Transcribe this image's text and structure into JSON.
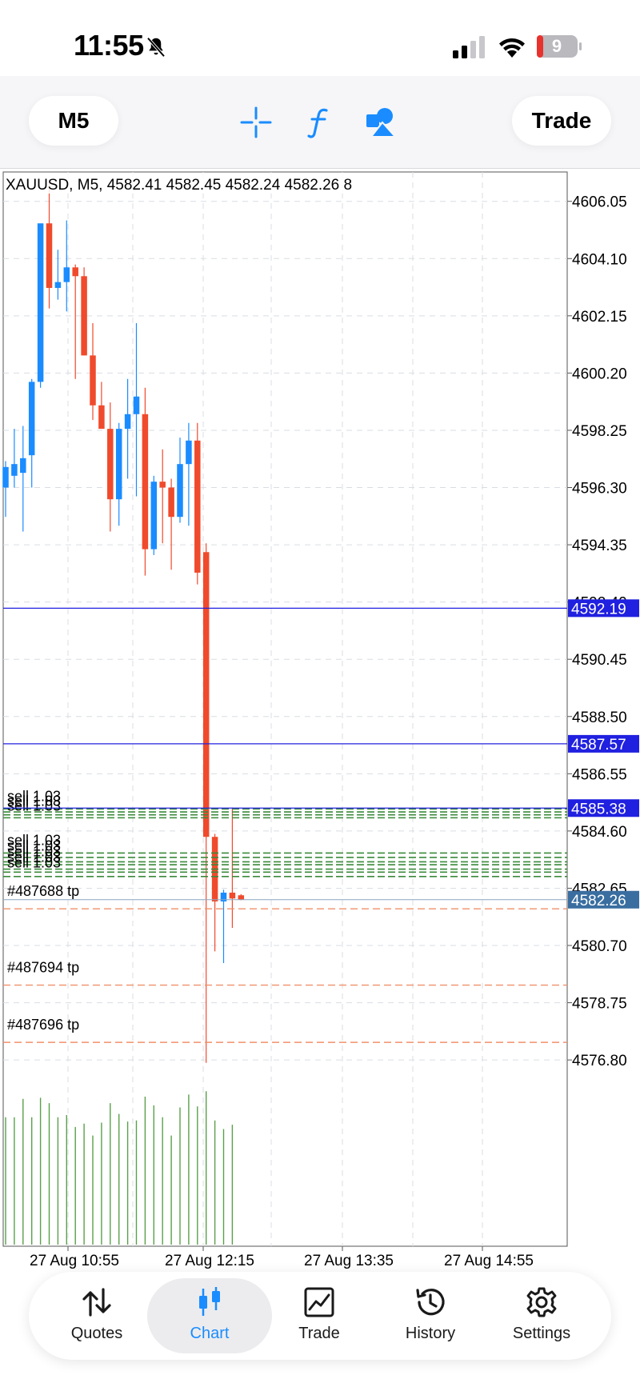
{
  "status_bar": {
    "time": "11:55",
    "battery": "9"
  },
  "toolbar": {
    "timeframe": "M5",
    "trade_label": "Trade"
  },
  "colors": {
    "bull": "#1a8cff",
    "bear": "#f04a2c",
    "hline": "#2020e0",
    "order": "#3a8a3a",
    "tp": "#f0906a",
    "last_price": "#3a6ea0",
    "grid": "#d9dde3",
    "volume": "#5aa04a"
  },
  "chart_data": {
    "type": "candlestick",
    "title": "XAUUSD, M5, 4582.41 4582.45 4582.24 4582.26 8",
    "ylim": [
      4575.85,
      4607.05
    ],
    "y_ticks": [
      "4606.05",
      "4604.10",
      "4602.15",
      "4600.20",
      "4598.25",
      "4596.30",
      "4594.35",
      "4592.40",
      "4590.45",
      "4588.50",
      "4586.55",
      "4584.60",
      "4582.65",
      "4580.70",
      "4578.75",
      "4576.80"
    ],
    "x_ticks": [
      "27 Aug 10:55",
      "27 Aug 12:15",
      "27 Aug 13:35",
      "27 Aug 14:55"
    ],
    "price_levels": [
      {
        "label": "4592.19",
        "value": 4592.19,
        "style": "blue"
      },
      {
        "label": "4587.57",
        "value": 4587.57,
        "style": "blue"
      },
      {
        "label": "4585.38",
        "value": 4585.38,
        "style": "blue"
      },
      {
        "label": "4582.26",
        "value": 4582.26,
        "style": "last"
      }
    ],
    "order_lines": {
      "upper_label": "sell 1.03",
      "upper_values": [
        4585.35,
        4585.25,
        4585.15,
        4585.05
      ],
      "lower_label": "sell 1.03",
      "lower_values": [
        4583.85,
        4583.7,
        4583.55,
        4583.45,
        4583.3,
        4583.2,
        4583.05
      ]
    },
    "tp_lines": [
      {
        "label": "#487688 tp",
        "value": 4581.95
      },
      {
        "label": "#487694 tp",
        "value": 4579.35
      },
      {
        "label": "#487696 tp",
        "value": 4577.4
      }
    ],
    "candles": [
      {
        "o": 4596.3,
        "h": 4597.2,
        "l": 4595.3,
        "c": 4597.0
      },
      {
        "o": 4596.7,
        "h": 4598.3,
        "l": 4596.3,
        "c": 4597.1
      },
      {
        "o": 4596.8,
        "h": 4598.4,
        "l": 4594.8,
        "c": 4597.3
      },
      {
        "o": 4597.4,
        "h": 4600.0,
        "l": 4596.3,
        "c": 4599.9
      },
      {
        "o": 4599.9,
        "h": 4605.0,
        "l": 4599.7,
        "c": 4605.3
      },
      {
        "o": 4605.3,
        "h": 4606.7,
        "l": 4602.4,
        "c": 4603.1
      },
      {
        "o": 4603.1,
        "h": 4604.4,
        "l": 4602.7,
        "c": 4603.3
      },
      {
        "o": 4603.3,
        "h": 4605.4,
        "l": 4602.3,
        "c": 4603.8
      },
      {
        "o": 4603.8,
        "h": 4603.9,
        "l": 4600.0,
        "c": 4603.5
      },
      {
        "o": 4603.5,
        "h": 4603.8,
        "l": 4600.8,
        "c": 4600.8
      },
      {
        "o": 4600.8,
        "h": 4601.9,
        "l": 4598.6,
        "c": 4599.1
      },
      {
        "o": 4599.1,
        "h": 4599.9,
        "l": 4598.5,
        "c": 4598.3
      },
      {
        "o": 4598.3,
        "h": 4599.2,
        "l": 4594.8,
        "c": 4595.9
      },
      {
        "o": 4595.9,
        "h": 4598.5,
        "l": 4595.0,
        "c": 4598.3
      },
      {
        "o": 4598.3,
        "h": 4600.0,
        "l": 4596.6,
        "c": 4598.8
      },
      {
        "o": 4598.8,
        "h": 4601.9,
        "l": 4596.0,
        "c": 4599.4
      },
      {
        "o": 4598.8,
        "h": 4599.7,
        "l": 4593.3,
        "c": 4594.2
      },
      {
        "o": 4594.2,
        "h": 4596.7,
        "l": 4594.0,
        "c": 4596.5
      },
      {
        "o": 4596.5,
        "h": 4597.6,
        "l": 4594.4,
        "c": 4596.3
      },
      {
        "o": 4596.3,
        "h": 4596.6,
        "l": 4593.5,
        "c": 4595.3
      },
      {
        "o": 4595.3,
        "h": 4598.0,
        "l": 4595.1,
        "c": 4597.1
      },
      {
        "o": 4597.1,
        "h": 4598.5,
        "l": 4595.0,
        "c": 4597.9
      },
      {
        "o": 4597.9,
        "h": 4598.5,
        "l": 4593.0,
        "c": 4593.4
      },
      {
        "o": 4594.1,
        "h": 4594.4,
        "l": 4576.7,
        "c": 4584.4
      },
      {
        "o": 4584.4,
        "h": 4584.5,
        "l": 4580.5,
        "c": 4582.2
      },
      {
        "o": 4582.2,
        "h": 4582.6,
        "l": 4580.1,
        "c": 4582.5
      },
      {
        "o": 4582.5,
        "h": 4585.4,
        "l": 4581.3,
        "c": 4582.3
      },
      {
        "o": 4582.41,
        "h": 4582.45,
        "l": 4582.24,
        "c": 4582.26
      }
    ],
    "volume": [
      1.18,
      1.18,
      1.35,
      1.18,
      1.36,
      1.31,
      1.18,
      1.2,
      1.09,
      1.12,
      1.01,
      1.13,
      1.31,
      1.21,
      1.14,
      1.15,
      1.37,
      1.29,
      1.18,
      1.01,
      1.27,
      1.39,
      1.28,
      1.42,
      1.15,
      1.07,
      1.11,
      0.0
    ]
  },
  "nav": [
    {
      "label": "Quotes",
      "icon": "quotes-icon"
    },
    {
      "label": "Chart",
      "icon": "chart-icon"
    },
    {
      "label": "Trade",
      "icon": "trade-icon"
    },
    {
      "label": "History",
      "icon": "history-icon"
    },
    {
      "label": "Settings",
      "icon": "settings-icon"
    }
  ]
}
